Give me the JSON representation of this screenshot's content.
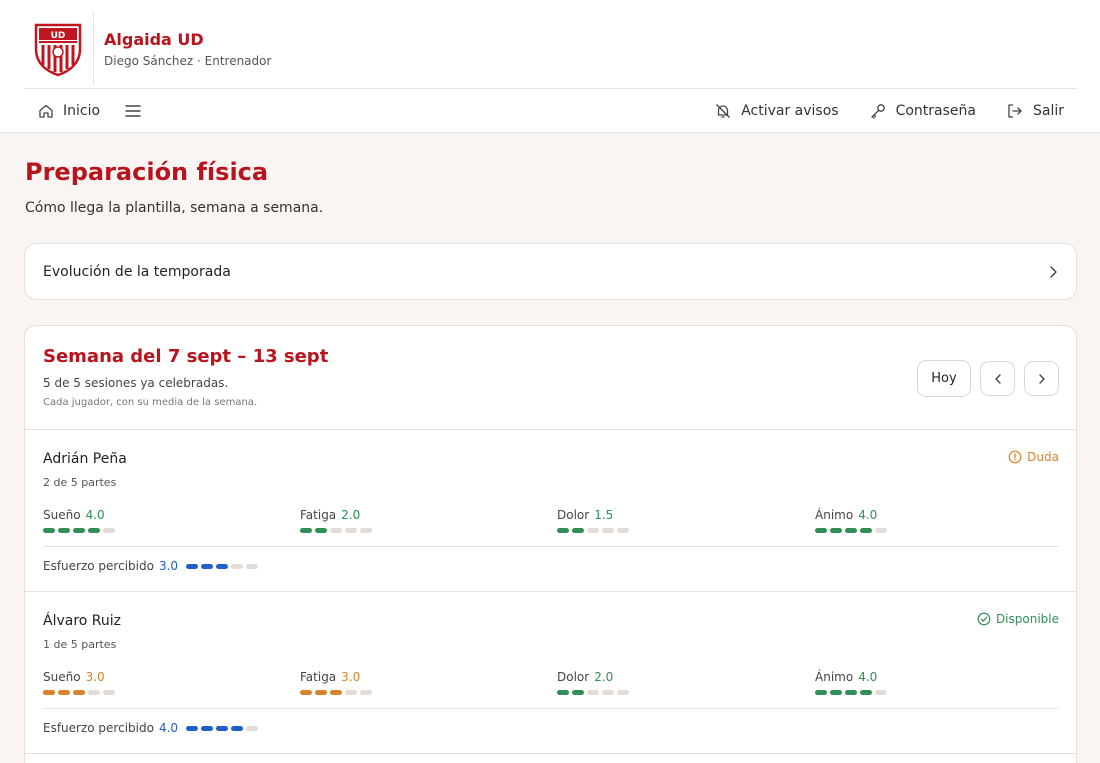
{
  "app": {
    "title": "Algaida UD",
    "subtitle": "Diego Sánchez · Entrenador",
    "logo_text": "UD"
  },
  "nav": {
    "home_label": "Inicio",
    "menu_icon": "hamburger-icon",
    "alerts_label": "Activar avisos",
    "password_label": "Contraseña",
    "logout_label": "Salir"
  },
  "page": {
    "title": "Preparación física",
    "subtitle": "Cómo llega la plantilla, semana a semana."
  },
  "season_card": {
    "label": "Evolución de la temporada"
  },
  "week": {
    "title": "Semana del 7 sept – 13 sept",
    "sessions": "5 de 5 sesiones ya celebradas.",
    "note": "Cada jugador, con su media de la semana.",
    "today_button": "Hoy"
  },
  "colors": {
    "brand": "#b9141d",
    "green": "#2f8f54",
    "orange": "#d9822b",
    "blue": "#1f5fc8",
    "empty": "#e2dcd8"
  },
  "players": [
    {
      "name": "Adrián Peña",
      "parts": "2 de 5 partes",
      "status": "Duda",
      "status_color": "#d9822b",
      "status_icon": "alert-circle-icon",
      "metrics": [
        {
          "label": "Sueño",
          "value": "4.0",
          "level": 4,
          "color": "#2f8f54"
        },
        {
          "label": "Fatiga",
          "value": "2.0",
          "level": 2,
          "color": "#2f8f54"
        },
        {
          "label": "Dolor",
          "value": "1.5",
          "level": 2,
          "color": "#2f8f54"
        },
        {
          "label": "Ánimo",
          "value": "4.0",
          "level": 4,
          "color": "#2f8f54"
        }
      ],
      "effort": {
        "label": "Esfuerzo percibido",
        "value": "3.0",
        "level": 3,
        "color": "#1f5fc8"
      }
    },
    {
      "name": "Álvaro Ruiz",
      "parts": "1 de 5 partes",
      "status": "Disponible",
      "status_color": "#2f8f54",
      "status_icon": "check-circle-icon",
      "metrics": [
        {
          "label": "Sueño",
          "value": "3.0",
          "level": 3,
          "color": "#d9822b"
        },
        {
          "label": "Fatiga",
          "value": "3.0",
          "level": 3,
          "color": "#d9822b"
        },
        {
          "label": "Dolor",
          "value": "2.0",
          "level": 2,
          "color": "#2f8f54"
        },
        {
          "label": "Ánimo",
          "value": "4.0",
          "level": 4,
          "color": "#2f8f54"
        }
      ],
      "effort": {
        "label": "Esfuerzo percibido",
        "value": "4.0",
        "level": 4,
        "color": "#1f5fc8"
      }
    }
  ]
}
